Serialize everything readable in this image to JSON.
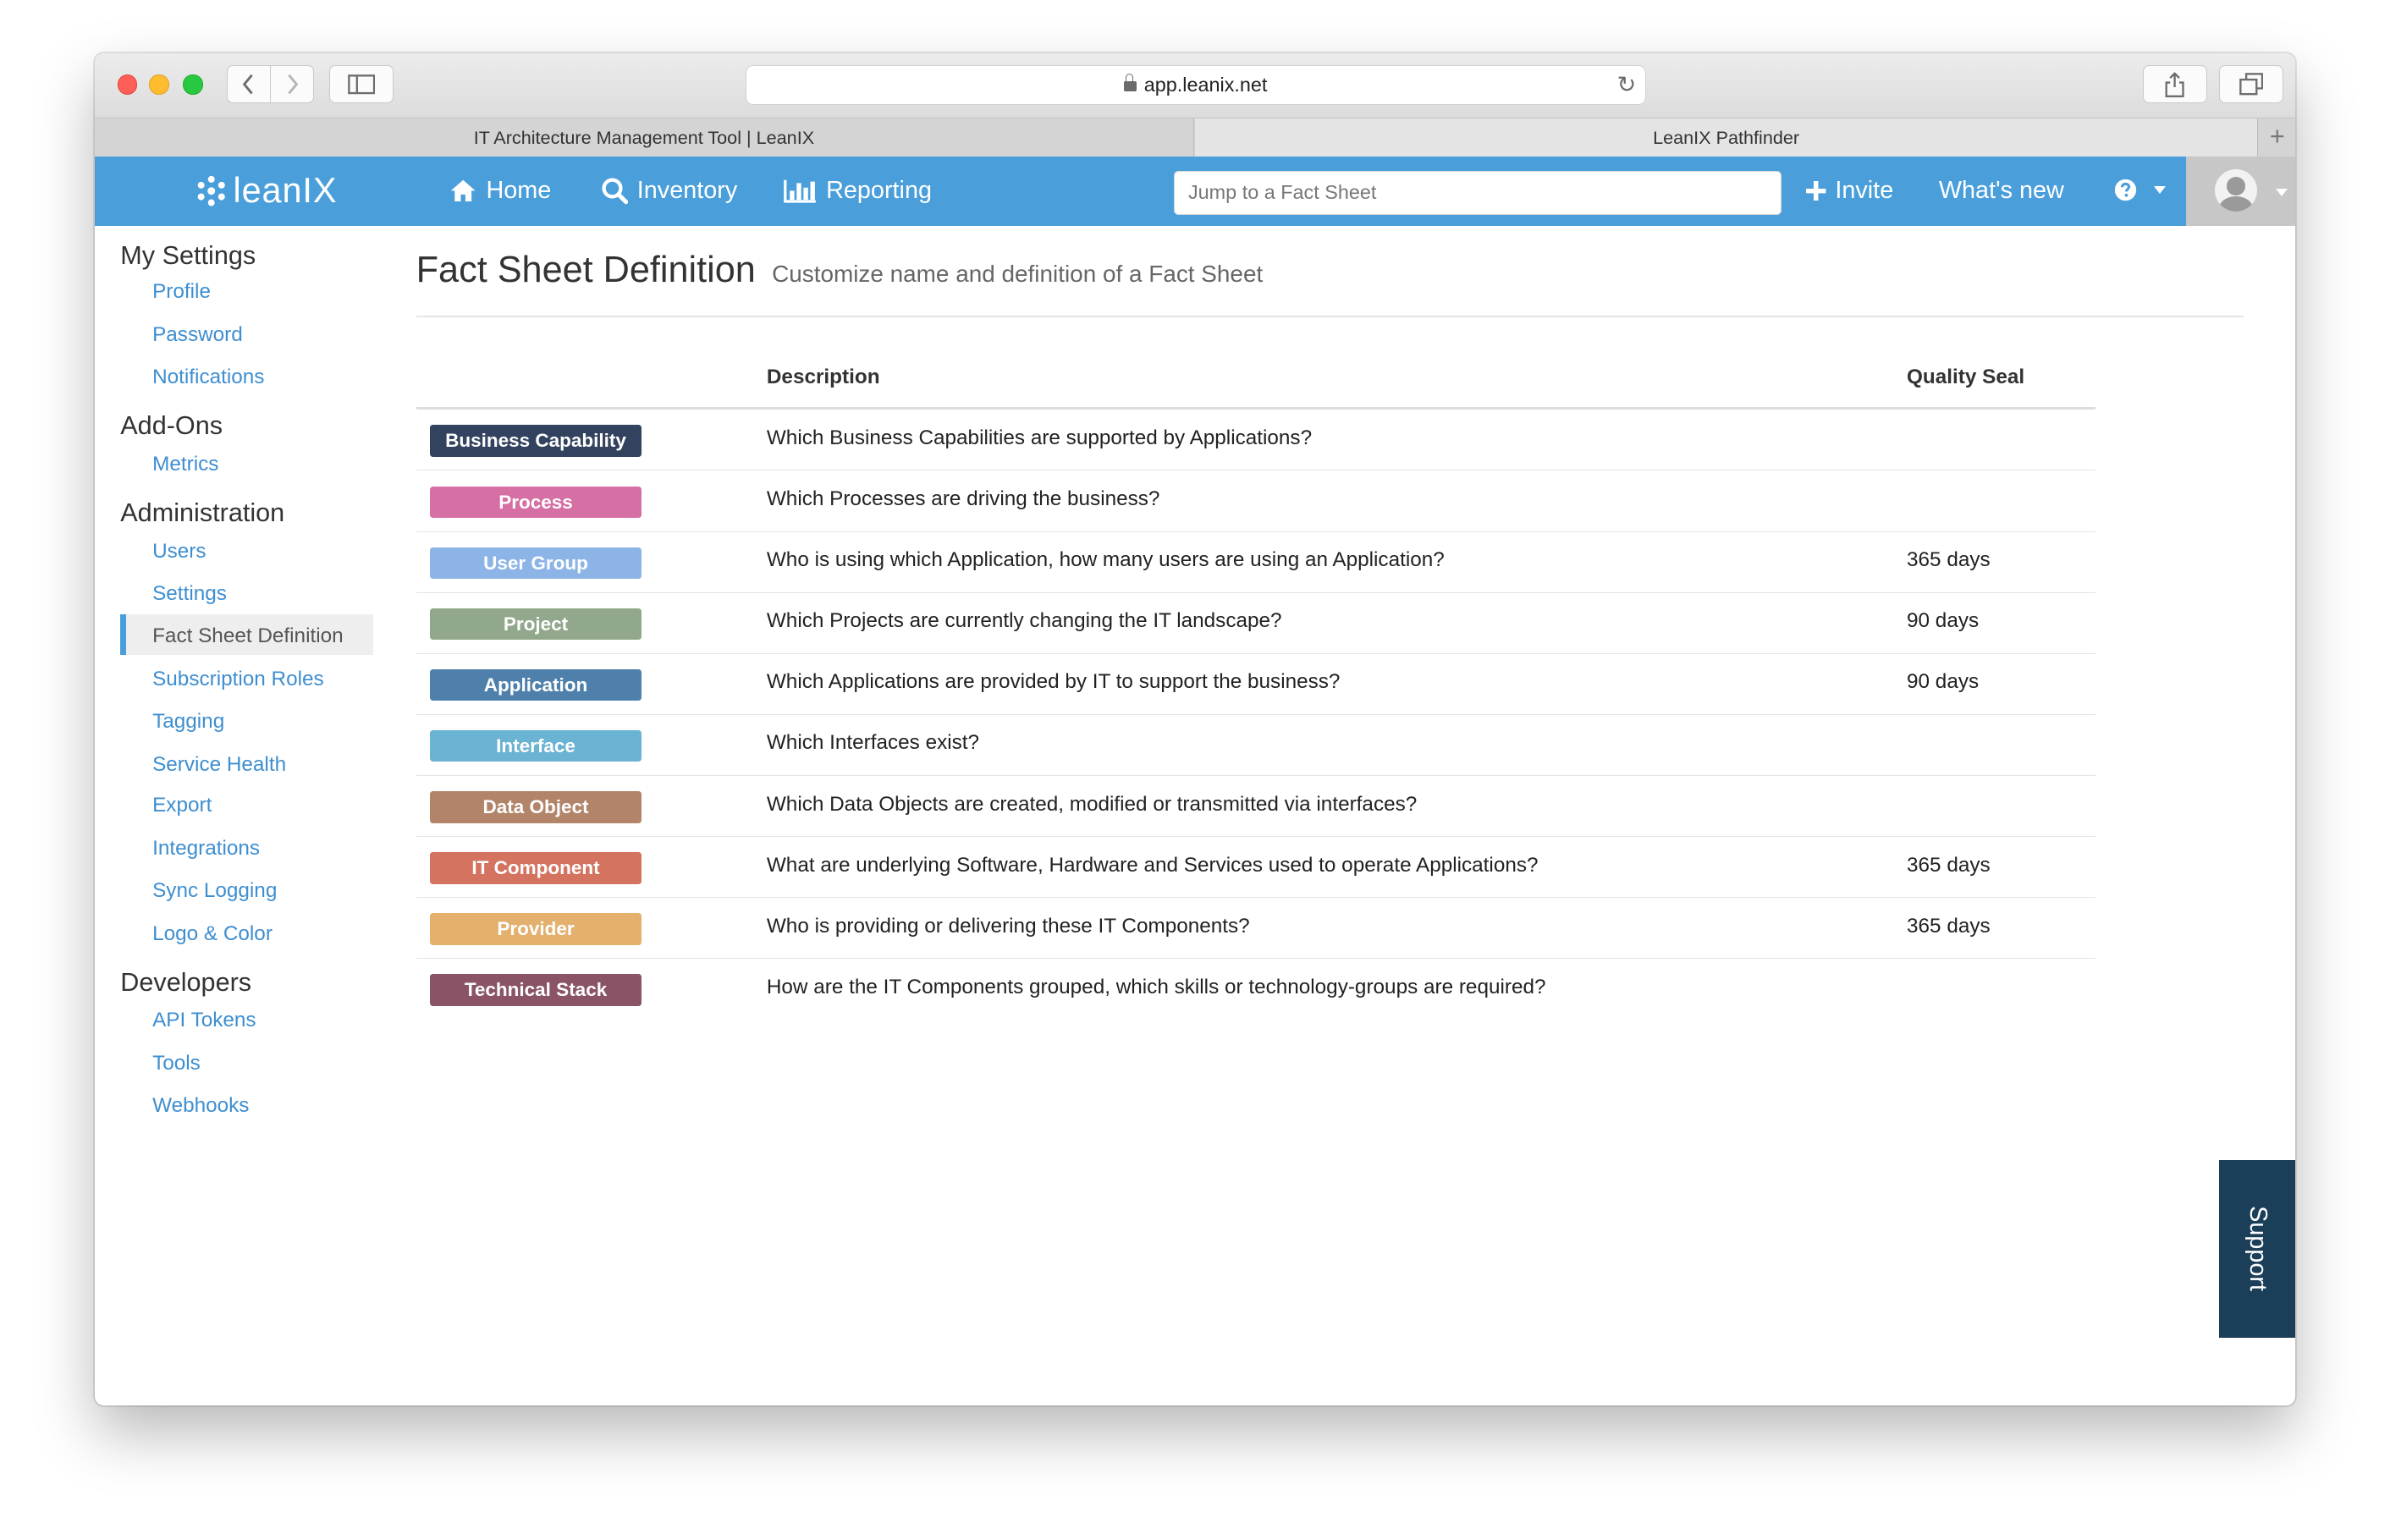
{
  "browser": {
    "url": "app.leanix.net",
    "tabs": [
      {
        "label": "IT Architecture Management Tool | LeanIX"
      },
      {
        "label": "LeanIX Pathfinder"
      }
    ]
  },
  "nav": {
    "logo": "leanIX",
    "home": "Home",
    "inventory": "Inventory",
    "reporting": "Reporting",
    "search_placeholder": "Jump to a Fact Sheet",
    "invite": "Invite",
    "whats_new": "What's new"
  },
  "sidebar": {
    "sections": [
      {
        "heading": "My Settings",
        "items": [
          "Profile",
          "Password",
          "Notifications"
        ]
      },
      {
        "heading": "Add-Ons",
        "items": [
          "Metrics"
        ]
      },
      {
        "heading": "Administration",
        "items": [
          "Users",
          "Settings",
          "Fact Sheet Definition",
          "Subscription Roles",
          "Tagging",
          "Service Health",
          "Export",
          "Integrations",
          "Sync Logging",
          "Logo & Color"
        ]
      },
      {
        "heading": "Developers",
        "items": [
          "API Tokens",
          "Tools",
          "Webhooks"
        ]
      }
    ],
    "active_item": "Fact Sheet Definition"
  },
  "main": {
    "title": "Fact Sheet Definition",
    "subtitle": "Customize name and definition of a Fact Sheet",
    "columns": {
      "description": "Description",
      "quality_seal": "Quality Seal"
    },
    "rows": [
      {
        "name": "Business Capability",
        "color": "#33425f",
        "description": "Which Business Capabilities are supported by Applications?",
        "seal": ""
      },
      {
        "name": "Process",
        "color": "#d66fa3",
        "description": "Which Processes are driving the business?",
        "seal": ""
      },
      {
        "name": "User Group",
        "color": "#8db4e6",
        "description": "Who is using which Application, how many users are using an Application?",
        "seal": "365 days"
      },
      {
        "name": "Project",
        "color": "#92a88c",
        "description": "Which Projects are currently changing the IT landscape?",
        "seal": "90 days"
      },
      {
        "name": "Application",
        "color": "#4f80ab",
        "description": "Which Applications are provided by IT to support the business?",
        "seal": "90 days"
      },
      {
        "name": "Interface",
        "color": "#6bb3d2",
        "description": "Which Interfaces exist?",
        "seal": ""
      },
      {
        "name": "Data Object",
        "color": "#b2856a",
        "description": "Which Data Objects are created, modified or transmitted via interfaces?",
        "seal": ""
      },
      {
        "name": "IT Component",
        "color": "#d4735f",
        "description": "What are underlying Software, Hardware and Services used to operate Applications?",
        "seal": "365 days"
      },
      {
        "name": "Provider",
        "color": "#e3b06e",
        "description": "Who is providing or delivering these IT Components?",
        "seal": "365 days"
      },
      {
        "name": "Technical Stack",
        "color": "#8a5466",
        "description": "How are the IT Components grouped, which skills or technology-groups are required?",
        "seal": ""
      }
    ]
  },
  "support": {
    "label": "Support"
  }
}
